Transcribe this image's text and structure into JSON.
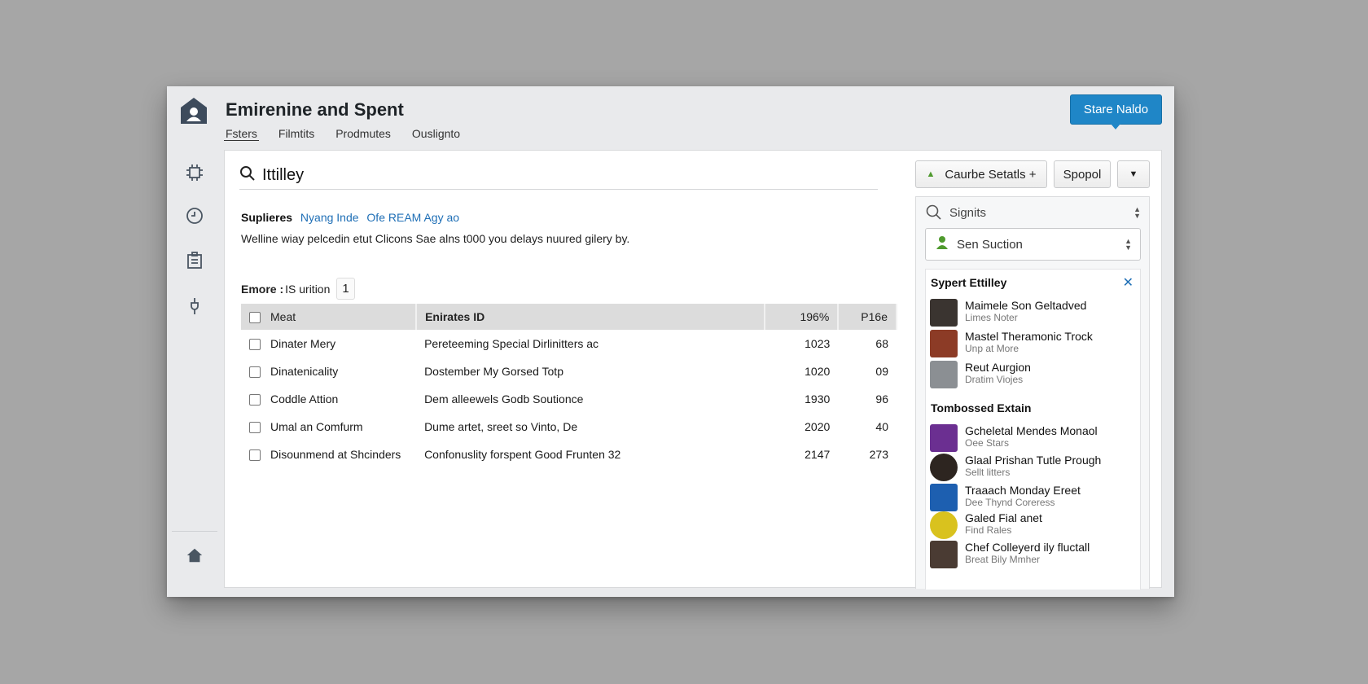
{
  "header": {
    "title": "Emirenine and Spent",
    "primary_button": "Stare Naldo",
    "tabs": [
      "Fsters",
      "Filmtits",
      "Prodmutes",
      "Ouslignto"
    ]
  },
  "toolbar": {
    "course_button": "Caurbe Setatls +",
    "spool_button": "Spopol"
  },
  "search": {
    "value": "Ittilley"
  },
  "info": {
    "title": "Suplieres",
    "link1": "Nyang Inde",
    "link2": "Ofe REAM Agy ao",
    "text": "Welline wiay pelcedin etut Clicons Sae alns t000 you delays nuured gilery by."
  },
  "count": {
    "label": "Emore :",
    "value": "IS urition",
    "chip": "1"
  },
  "table": {
    "headers": [
      "Meat",
      "Enirates ID",
      "196%",
      "P16e"
    ],
    "rows": [
      [
        "Dinater Mery",
        "Pereteeming Special Dirlinitters ac",
        "1023",
        "68"
      ],
      [
        "Dinatenicality",
        "Dostember My Gorsed Totp",
        "1020",
        "09"
      ],
      [
        "Coddle Attion",
        "Dem alleewels Godb Soutionce",
        "1930",
        "96"
      ],
      [
        "Umal an Comfurm",
        "Dume artet, sreet so Vinto, De",
        "2020",
        "40"
      ],
      [
        "Disounmend at Shcinders",
        "Confonuslity forspent Good Frunten 32",
        "2147",
        "273"
      ]
    ]
  },
  "side": {
    "search_placeholder": "Signits",
    "select_value": "Sen Suction",
    "section1_title": "Sypert Ettilley",
    "section2_title": "Tombossed Extain",
    "people": [
      {
        "name": "Maimele Son Geltadved",
        "sub": "Limes Noter",
        "color": "#3a3430"
      },
      {
        "name": "Mastel Theramonic Trock",
        "sub": "Unp at More",
        "color": "#8c3b26"
      },
      {
        "name": "Reut Aurgion",
        "sub": "Dratim Viojes",
        "color": "#8b8f93"
      }
    ],
    "people2": [
      {
        "name": "Gcheletal Mendes Monaol",
        "sub": "Oee Stars",
        "color": "#6b2f91"
      },
      {
        "name": "Glaal Prishan Tutle Prough",
        "sub": "Sellt litters",
        "color": "#2d2520"
      },
      {
        "name": "Traaach Monday Ereet",
        "sub": "Dee Thynd Coreress",
        "color": "#1d5fb0"
      },
      {
        "name": "Galed Fial anet",
        "sub": "Find Rales",
        "color": "#d9c21e"
      },
      {
        "name": "Chef Colleyerd ily fluctall",
        "sub": "Breat Bily Mmher",
        "color": "#4a3b33"
      }
    ]
  }
}
